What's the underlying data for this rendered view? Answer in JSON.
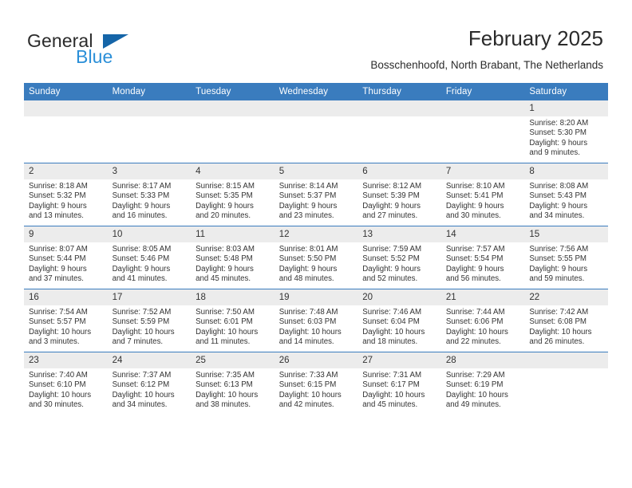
{
  "brand": {
    "word1": "General",
    "word2": "Blue",
    "accent_blue": "#1565a8",
    "light_blue": "#2b8fd8"
  },
  "header": {
    "title": "February 2025",
    "subtitle": "Bosschenhoofd, North Brabant, The Netherlands"
  },
  "calendar": {
    "header_bg": "#3a7cbe",
    "daynum_bg": "#ececec",
    "weekday_headers": [
      "Sunday",
      "Monday",
      "Tuesday",
      "Wednesday",
      "Thursday",
      "Friday",
      "Saturday"
    ],
    "weeks": [
      [
        {
          "day": "",
          "sunrise": "",
          "sunset": "",
          "daylight1": "",
          "daylight2": ""
        },
        {
          "day": "",
          "sunrise": "",
          "sunset": "",
          "daylight1": "",
          "daylight2": ""
        },
        {
          "day": "",
          "sunrise": "",
          "sunset": "",
          "daylight1": "",
          "daylight2": ""
        },
        {
          "day": "",
          "sunrise": "",
          "sunset": "",
          "daylight1": "",
          "daylight2": ""
        },
        {
          "day": "",
          "sunrise": "",
          "sunset": "",
          "daylight1": "",
          "daylight2": ""
        },
        {
          "day": "",
          "sunrise": "",
          "sunset": "",
          "daylight1": "",
          "daylight2": ""
        },
        {
          "day": "1",
          "sunrise": "Sunrise: 8:20 AM",
          "sunset": "Sunset: 5:30 PM",
          "daylight1": "Daylight: 9 hours",
          "daylight2": "and 9 minutes."
        }
      ],
      [
        {
          "day": "2",
          "sunrise": "Sunrise: 8:18 AM",
          "sunset": "Sunset: 5:32 PM",
          "daylight1": "Daylight: 9 hours",
          "daylight2": "and 13 minutes."
        },
        {
          "day": "3",
          "sunrise": "Sunrise: 8:17 AM",
          "sunset": "Sunset: 5:33 PM",
          "daylight1": "Daylight: 9 hours",
          "daylight2": "and 16 minutes."
        },
        {
          "day": "4",
          "sunrise": "Sunrise: 8:15 AM",
          "sunset": "Sunset: 5:35 PM",
          "daylight1": "Daylight: 9 hours",
          "daylight2": "and 20 minutes."
        },
        {
          "day": "5",
          "sunrise": "Sunrise: 8:14 AM",
          "sunset": "Sunset: 5:37 PM",
          "daylight1": "Daylight: 9 hours",
          "daylight2": "and 23 minutes."
        },
        {
          "day": "6",
          "sunrise": "Sunrise: 8:12 AM",
          "sunset": "Sunset: 5:39 PM",
          "daylight1": "Daylight: 9 hours",
          "daylight2": "and 27 minutes."
        },
        {
          "day": "7",
          "sunrise": "Sunrise: 8:10 AM",
          "sunset": "Sunset: 5:41 PM",
          "daylight1": "Daylight: 9 hours",
          "daylight2": "and 30 minutes."
        },
        {
          "day": "8",
          "sunrise": "Sunrise: 8:08 AM",
          "sunset": "Sunset: 5:43 PM",
          "daylight1": "Daylight: 9 hours",
          "daylight2": "and 34 minutes."
        }
      ],
      [
        {
          "day": "9",
          "sunrise": "Sunrise: 8:07 AM",
          "sunset": "Sunset: 5:44 PM",
          "daylight1": "Daylight: 9 hours",
          "daylight2": "and 37 minutes."
        },
        {
          "day": "10",
          "sunrise": "Sunrise: 8:05 AM",
          "sunset": "Sunset: 5:46 PM",
          "daylight1": "Daylight: 9 hours",
          "daylight2": "and 41 minutes."
        },
        {
          "day": "11",
          "sunrise": "Sunrise: 8:03 AM",
          "sunset": "Sunset: 5:48 PM",
          "daylight1": "Daylight: 9 hours",
          "daylight2": "and 45 minutes."
        },
        {
          "day": "12",
          "sunrise": "Sunrise: 8:01 AM",
          "sunset": "Sunset: 5:50 PM",
          "daylight1": "Daylight: 9 hours",
          "daylight2": "and 48 minutes."
        },
        {
          "day": "13",
          "sunrise": "Sunrise: 7:59 AM",
          "sunset": "Sunset: 5:52 PM",
          "daylight1": "Daylight: 9 hours",
          "daylight2": "and 52 minutes."
        },
        {
          "day": "14",
          "sunrise": "Sunrise: 7:57 AM",
          "sunset": "Sunset: 5:54 PM",
          "daylight1": "Daylight: 9 hours",
          "daylight2": "and 56 minutes."
        },
        {
          "day": "15",
          "sunrise": "Sunrise: 7:56 AM",
          "sunset": "Sunset: 5:55 PM",
          "daylight1": "Daylight: 9 hours",
          "daylight2": "and 59 minutes."
        }
      ],
      [
        {
          "day": "16",
          "sunrise": "Sunrise: 7:54 AM",
          "sunset": "Sunset: 5:57 PM",
          "daylight1": "Daylight: 10 hours",
          "daylight2": "and 3 minutes."
        },
        {
          "day": "17",
          "sunrise": "Sunrise: 7:52 AM",
          "sunset": "Sunset: 5:59 PM",
          "daylight1": "Daylight: 10 hours",
          "daylight2": "and 7 minutes."
        },
        {
          "day": "18",
          "sunrise": "Sunrise: 7:50 AM",
          "sunset": "Sunset: 6:01 PM",
          "daylight1": "Daylight: 10 hours",
          "daylight2": "and 11 minutes."
        },
        {
          "day": "19",
          "sunrise": "Sunrise: 7:48 AM",
          "sunset": "Sunset: 6:03 PM",
          "daylight1": "Daylight: 10 hours",
          "daylight2": "and 14 minutes."
        },
        {
          "day": "20",
          "sunrise": "Sunrise: 7:46 AM",
          "sunset": "Sunset: 6:04 PM",
          "daylight1": "Daylight: 10 hours",
          "daylight2": "and 18 minutes."
        },
        {
          "day": "21",
          "sunrise": "Sunrise: 7:44 AM",
          "sunset": "Sunset: 6:06 PM",
          "daylight1": "Daylight: 10 hours",
          "daylight2": "and 22 minutes."
        },
        {
          "day": "22",
          "sunrise": "Sunrise: 7:42 AM",
          "sunset": "Sunset: 6:08 PM",
          "daylight1": "Daylight: 10 hours",
          "daylight2": "and 26 minutes."
        }
      ],
      [
        {
          "day": "23",
          "sunrise": "Sunrise: 7:40 AM",
          "sunset": "Sunset: 6:10 PM",
          "daylight1": "Daylight: 10 hours",
          "daylight2": "and 30 minutes."
        },
        {
          "day": "24",
          "sunrise": "Sunrise: 7:37 AM",
          "sunset": "Sunset: 6:12 PM",
          "daylight1": "Daylight: 10 hours",
          "daylight2": "and 34 minutes."
        },
        {
          "day": "25",
          "sunrise": "Sunrise: 7:35 AM",
          "sunset": "Sunset: 6:13 PM",
          "daylight1": "Daylight: 10 hours",
          "daylight2": "and 38 minutes."
        },
        {
          "day": "26",
          "sunrise": "Sunrise: 7:33 AM",
          "sunset": "Sunset: 6:15 PM",
          "daylight1": "Daylight: 10 hours",
          "daylight2": "and 42 minutes."
        },
        {
          "day": "27",
          "sunrise": "Sunrise: 7:31 AM",
          "sunset": "Sunset: 6:17 PM",
          "daylight1": "Daylight: 10 hours",
          "daylight2": "and 45 minutes."
        },
        {
          "day": "28",
          "sunrise": "Sunrise: 7:29 AM",
          "sunset": "Sunset: 6:19 PM",
          "daylight1": "Daylight: 10 hours",
          "daylight2": "and 49 minutes."
        },
        {
          "day": "",
          "sunrise": "",
          "sunset": "",
          "daylight1": "",
          "daylight2": ""
        }
      ]
    ]
  }
}
